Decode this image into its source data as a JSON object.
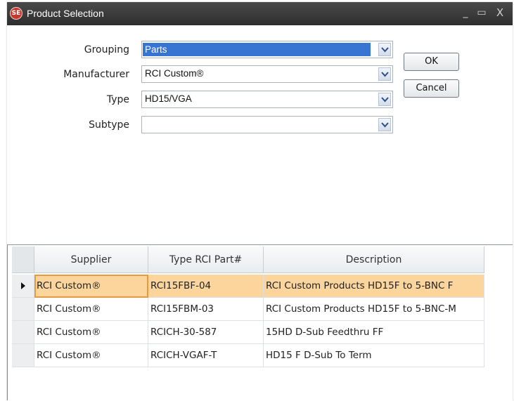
{
  "window": {
    "title": "Product Selection",
    "icon_text": "SE",
    "controls": {
      "minimize": "_",
      "maximize": "▭",
      "close": "X"
    }
  },
  "form": {
    "grouping": {
      "label": "Grouping",
      "value": "Parts"
    },
    "manufacturer": {
      "label": "Manufacturer",
      "value": "RCI Custom®"
    },
    "type": {
      "label": "Type",
      "value": "HD15/VGA"
    },
    "subtype": {
      "label": "Subtype",
      "value": ""
    }
  },
  "buttons": {
    "ok": "OK",
    "cancel": "Cancel"
  },
  "grid": {
    "columns": [
      "Supplier",
      "Type RCI Part#",
      "Description"
    ],
    "rows": [
      {
        "supplier": "RCI Custom®",
        "part": "RCI15FBF-04",
        "description": "RCI Custom Products HD15F to 5-BNC F",
        "selected": true
      },
      {
        "supplier": "RCI Custom®",
        "part": "RCI15FBM-03",
        "description": "RCI Custom Products HD15F to 5-BNC-M",
        "selected": false
      },
      {
        "supplier": "RCI Custom®",
        "part": "RCICH-30-587",
        "description": "15HD D-Sub Feedthru FF",
        "selected": false
      },
      {
        "supplier": "RCI Custom®",
        "part": "RCICH-VGAF-T",
        "description": "HD15 F D-Sub To Term",
        "selected": false
      }
    ]
  },
  "colors": {
    "titlebar": "#2e2e2e",
    "selection_highlight": "#3874d1",
    "active_row": "#fcd59d",
    "active_cell_border": "#e69a3a"
  }
}
